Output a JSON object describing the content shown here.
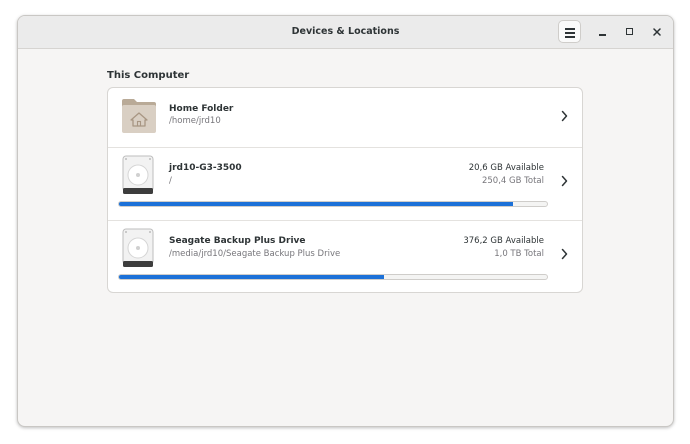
{
  "window": {
    "title": "Devices & Locations"
  },
  "section": {
    "title": "This Computer"
  },
  "locations": [
    {
      "name": "Home Folder",
      "path": "/home/jrd10",
      "icon": "home-folder-icon"
    },
    {
      "name": "jrd10-G3-3500",
      "path": "/",
      "available": "20,6 GB Available",
      "total": "250,4 GB Total",
      "usage_fraction": 0.92,
      "icon": "hard-drive-icon"
    },
    {
      "name": "Seagate Backup Plus Drive",
      "path": "/media/jrd10/Seagate Backup Plus Drive",
      "available": "376,2 GB Available",
      "total": "1,0 TB Total",
      "usage_fraction": 0.62,
      "icon": "hard-drive-icon"
    }
  ],
  "colors": {
    "accent": "#1c71d8",
    "window_bg": "#f6f5f4",
    "titlebar_bg": "#ebebeb"
  }
}
